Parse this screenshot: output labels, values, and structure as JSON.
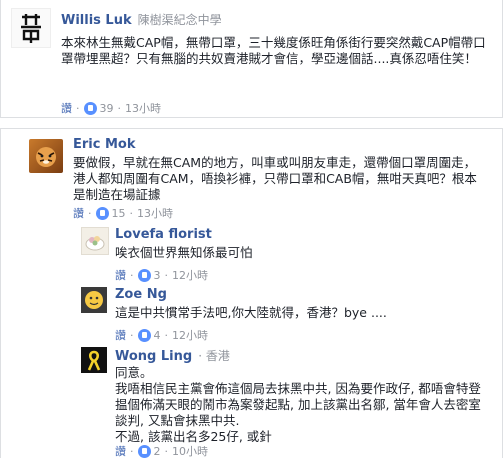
{
  "comments": [
    {
      "name": "Willis Luk",
      "subtitle": "陳樹渠紀念中學",
      "text": "本來林生無戴CAP帽，無帶口罩，三十幾度係旺角係街行要突然戴CAP帽帶口罩帶埋黑超？只有無腦的共奴賣港賊才會信，學亞邊個話....真係忍唔住笑！",
      "reply_label": "讚",
      "likes": "39",
      "time": "13小時"
    },
    {
      "name": "Eric Mok",
      "text": "要做假，早就在無CAM的地方，叫車或叫朋友車走，還帶個口罩周圍走，港人都知周圍有CAM，唔換衫褲，只帶口罩和CAB帽，無咁天真吧？根本是制造在場証據",
      "reply_label": "讚",
      "likes": "15",
      "time": "13小時"
    },
    {
      "name": "Lovefa florist",
      "text": "唉衣個世界無知係最可怕",
      "reply_label": "讚",
      "likes": "3",
      "time": "12小時"
    },
    {
      "name": "Zoe Ng",
      "text": "這是中共慣常手法吧,你大陸就得，香港？bye ....",
      "reply_label": "讚",
      "likes": "4",
      "time": "12小時"
    },
    {
      "name": "Wong Ling",
      "subtitle": "香港",
      "text_lines": [
        "同意。",
        "我唔相信民主黨會佈這個局去抹黑中共, 因為要作政仔, 都唔會特登揾個佈滿天眼的鬧市為案發起點, 加上該黨出名鄒, 當年會人去密室談判, 又點會抹黑中共.",
        "不過, 該黨出名多25仔, 或針"
      ],
      "reply_label": "讚",
      "likes": "2",
      "time": "10小時"
    }
  ],
  "colors": {
    "link": "#365899",
    "meta": "#90949c",
    "like": "#5890ff"
  }
}
